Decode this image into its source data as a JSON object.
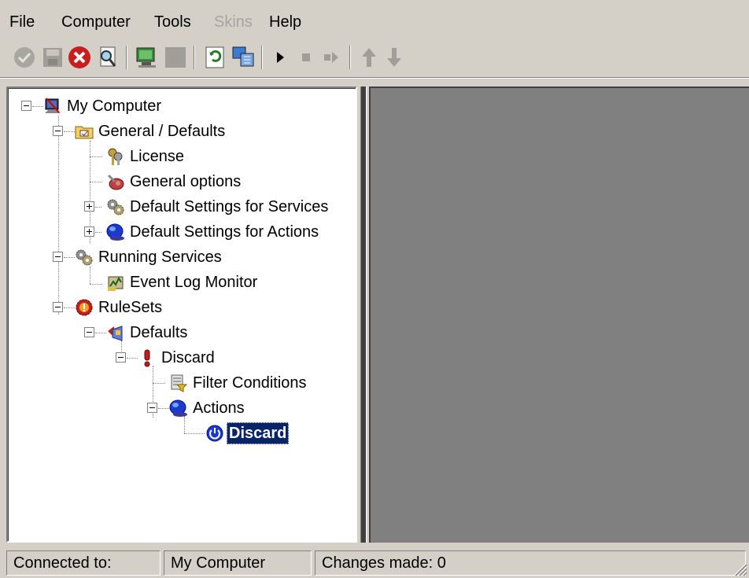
{
  "menu": {
    "file": "File",
    "computer": "Computer",
    "tools": "Tools",
    "skins": "Skins",
    "help": "Help"
  },
  "toolbar": {
    "buttons": [
      "apply-icon",
      "save-icon",
      "delete-icon",
      "find-icon",
      "connect-icon",
      "disconnect-icon",
      "refresh-icon",
      "properties-icon",
      "play-icon",
      "stop-icon",
      "step-icon",
      "move-up-icon",
      "move-down-icon"
    ]
  },
  "tree": {
    "my_computer": "My Computer",
    "general_defaults": "General / Defaults",
    "license": "License",
    "general_options": "General options",
    "default_services": "Default Settings for Services",
    "default_actions": "Default Settings for Actions",
    "running_services": "Running Services",
    "event_log_monitor": "Event Log Monitor",
    "rulesets": "RuleSets",
    "defaults": "Defaults",
    "discard_rule": "Discard",
    "filter_conditions": "Filter Conditions",
    "actions": "Actions",
    "discard_action": "Discard"
  },
  "status": {
    "connected_label": "Connected to:",
    "computer_name": "My Computer",
    "changes": "Changes made: 0"
  },
  "colors": {
    "chrome": "#d4d0c8",
    "selection": "#0a246a",
    "detail_bg": "#808080"
  }
}
